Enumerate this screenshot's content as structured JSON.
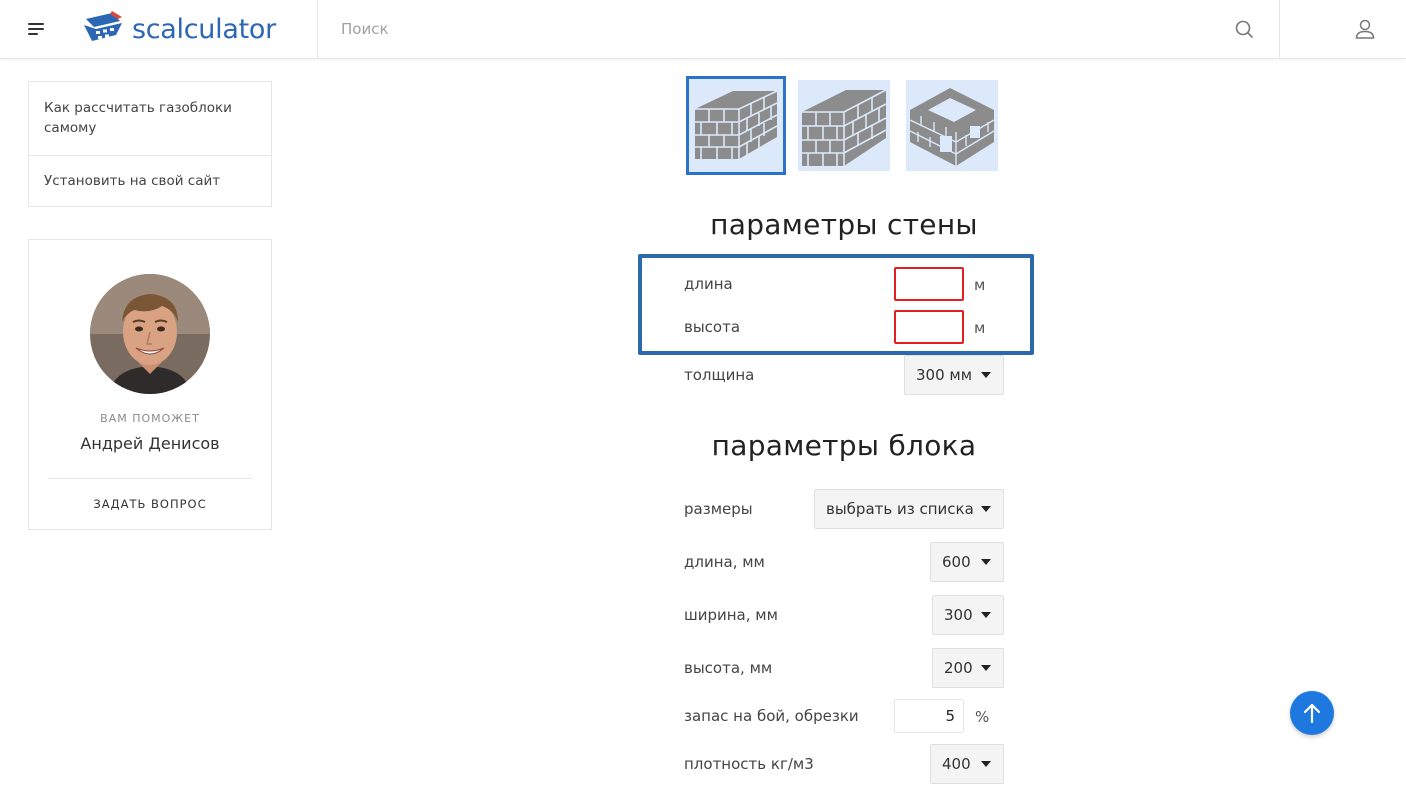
{
  "header": {
    "logo_text": "scalculator",
    "search_placeholder": "Поиск"
  },
  "sidebar": {
    "menu": [
      {
        "label": "Как рассчитать газоблоки самому"
      },
      {
        "label": "Установить на свой сайт"
      }
    ],
    "help_card": {
      "label": "ВАМ ПОМОЖЕТ",
      "name": "Андрей Денисов",
      "ask_button": "ЗАДАТЬ ВОПРОС"
    }
  },
  "main": {
    "wall_types": [
      {
        "name": "straight wall",
        "selected": true
      },
      {
        "name": "wall with corners",
        "selected": false
      },
      {
        "name": "house box",
        "selected": false
      }
    ],
    "wall_params": {
      "title": "параметры стены",
      "length_label": "длина",
      "length_value": "",
      "length_unit": "м",
      "height_label": "высота",
      "height_value": "",
      "height_unit": "м",
      "thickness_label": "толщина",
      "thickness_value": "300 мм"
    },
    "block_params": {
      "title": "параметры блока",
      "size_label": "размеры",
      "size_value": "выбрать из списка",
      "length_label": "длина, мм",
      "length_value": "600",
      "width_label": "ширина, мм",
      "width_value": "300",
      "height_label": "высота, мм",
      "height_value": "200",
      "reserve_label": "запас на бой, обрезки",
      "reserve_value": "5",
      "reserve_unit": "%",
      "density_label": "плотность кг/м3",
      "density_value": "400"
    }
  },
  "colors": {
    "brand": "#2b67b5",
    "highlight_box": "#2a6aad",
    "error_border": "#e02020",
    "scroll_button": "#1f78e0",
    "thumb_bg": "#dbe9fb"
  }
}
